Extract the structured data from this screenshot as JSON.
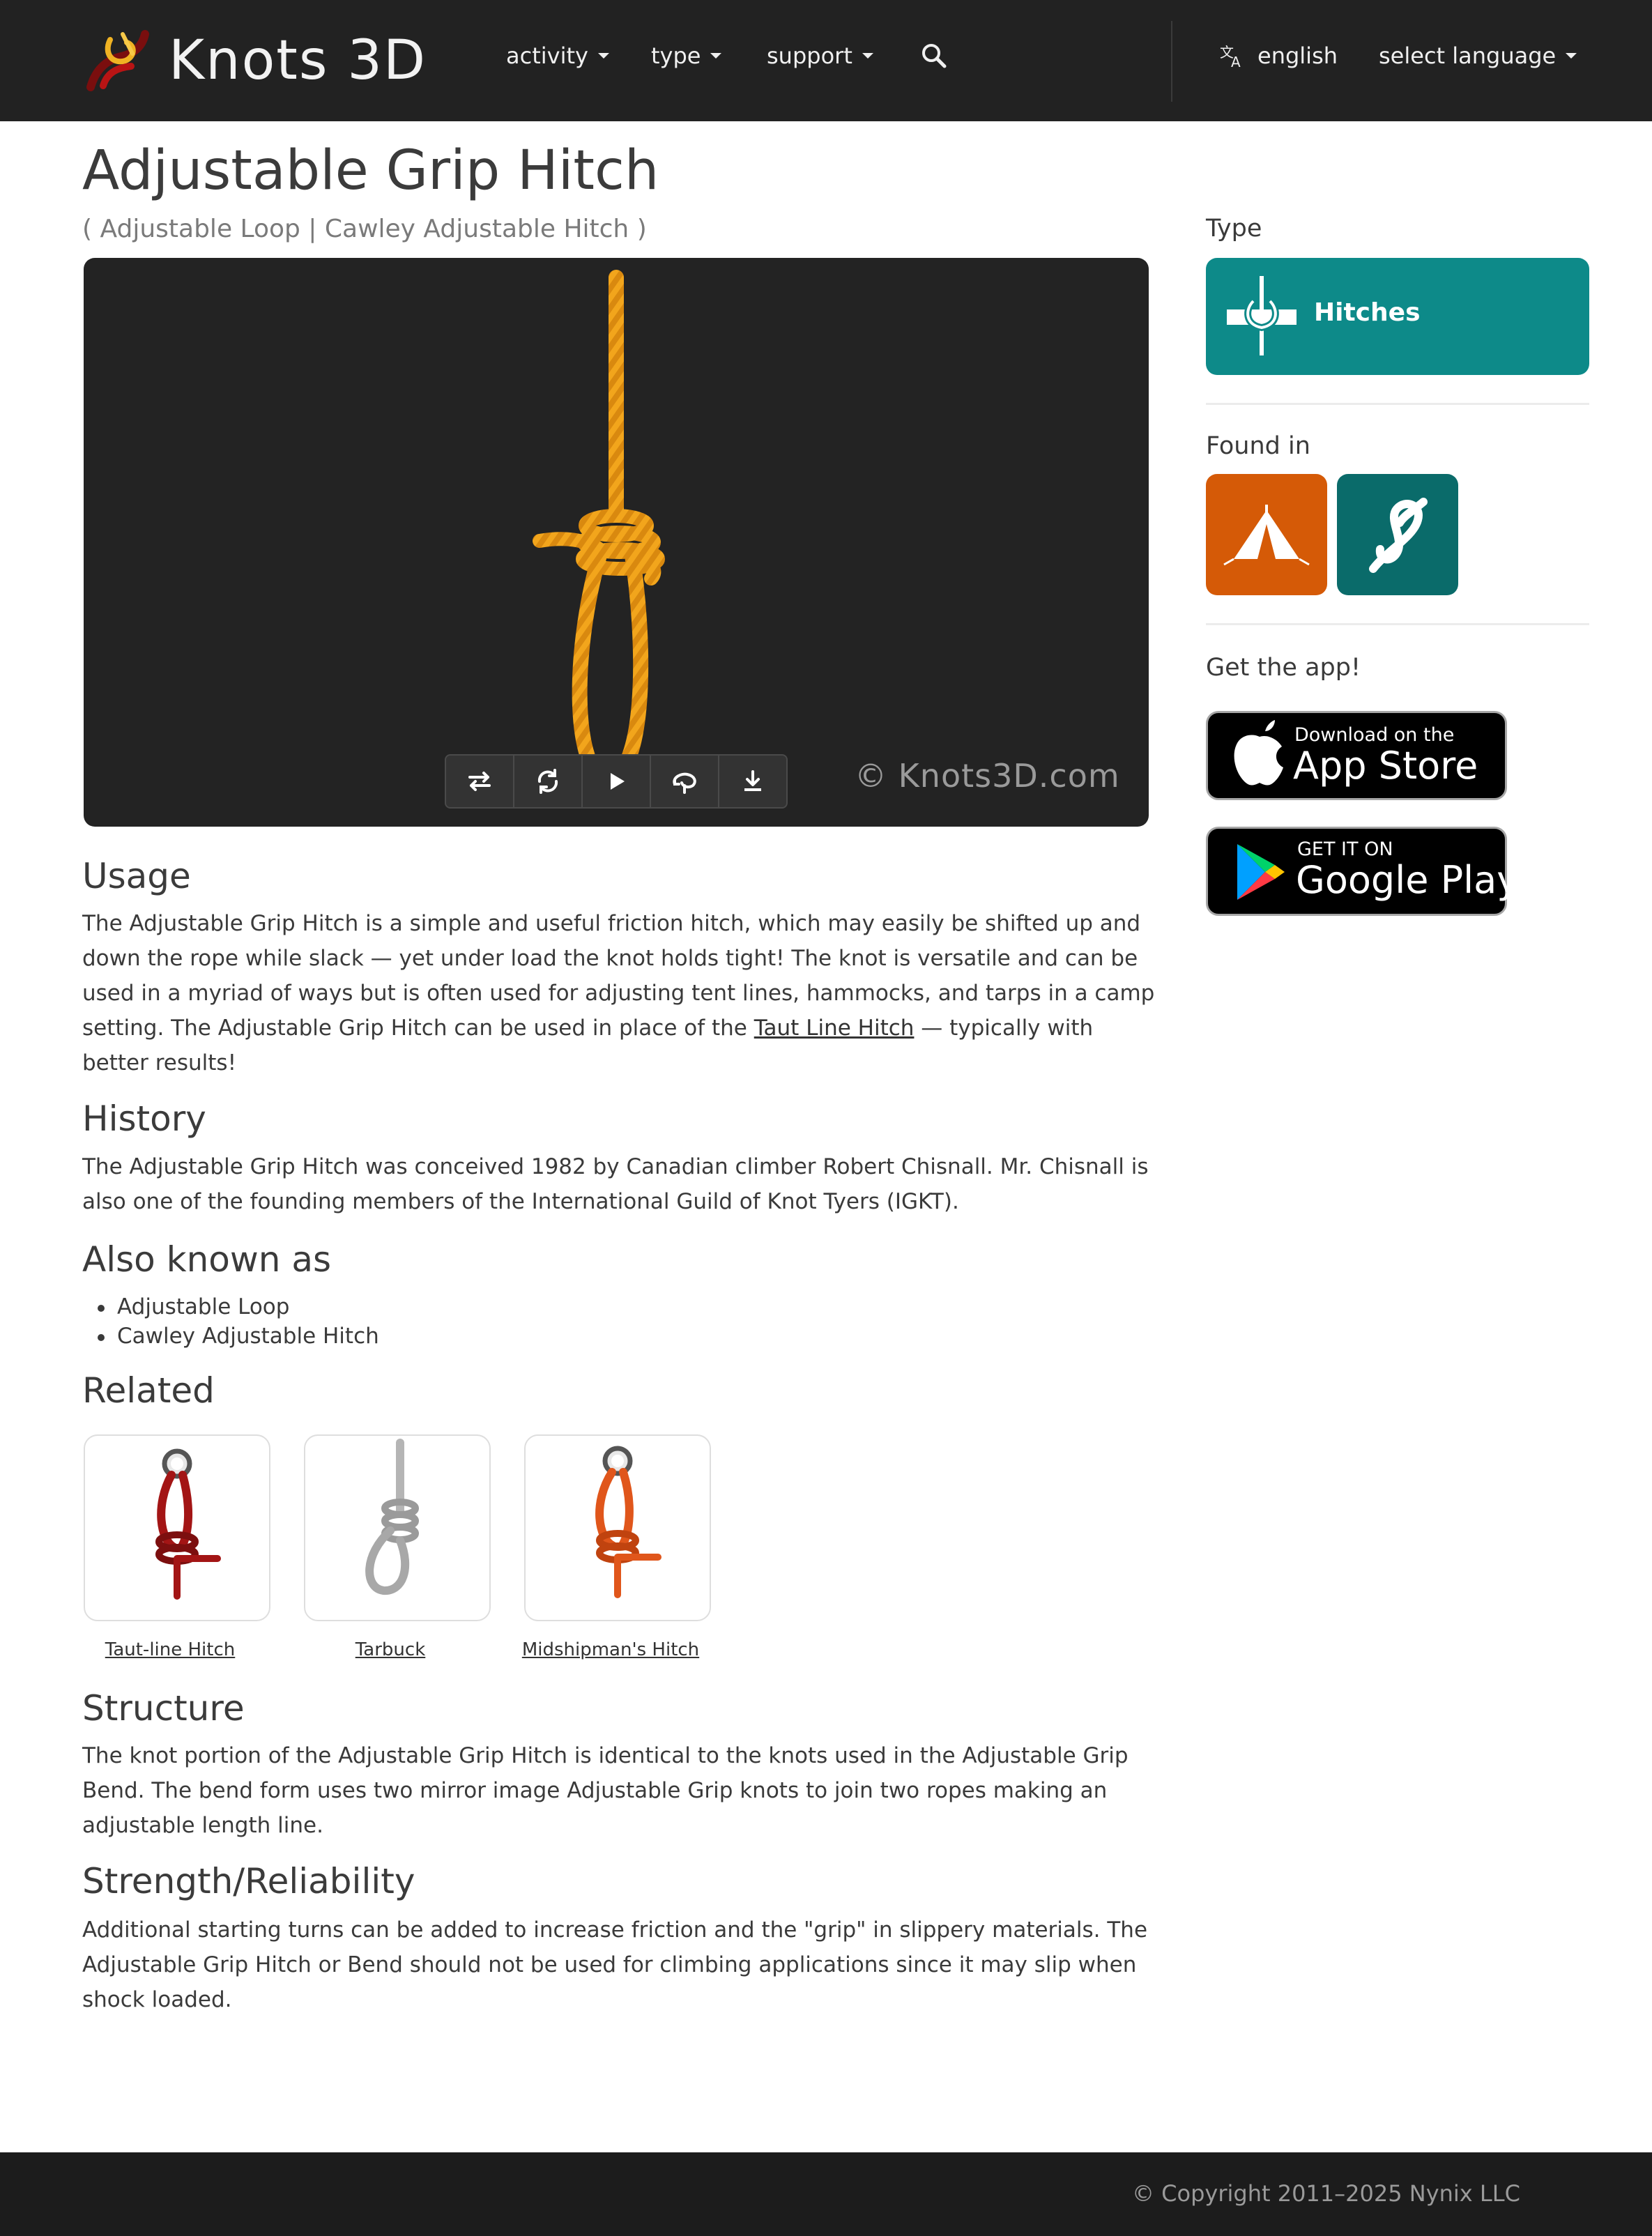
{
  "nav": {
    "brand": "Knots 3D",
    "menu": [
      {
        "label": "activity"
      },
      {
        "label": "type"
      },
      {
        "label": "support"
      }
    ],
    "language_current": "english",
    "language_select": "select language"
  },
  "page": {
    "title": "Adjustable Grip Hitch",
    "subtitle": "( Adjustable Loop | Cawley Adjustable Hitch )"
  },
  "viewer": {
    "watermark": "© Knots3D.com",
    "controls": [
      "swap-icon",
      "rotate-icon",
      "play-icon",
      "loop-icon",
      "download-icon"
    ]
  },
  "sections": {
    "usage": {
      "heading": "Usage",
      "text_before": "The Adjustable Grip Hitch is a simple and useful friction hitch, which may easily be shifted up and down the rope while slack — yet under load the knot holds tight! The knot is versatile and can be used in a myriad of ways but is often used for adjusting tent lines, hammocks, and tarps in a camp setting. The Adjustable Grip Hitch can be used in place of the ",
      "link": "Taut Line Hitch",
      "text_after": " — typically with better results!"
    },
    "history": {
      "heading": "History",
      "text": "The Adjustable Grip Hitch was conceived 1982 by Canadian climber Robert Chisnall. Mr. Chisnall is also one of the founding members of the International Guild of Knot Tyers (IGKT)."
    },
    "aka": {
      "heading": "Also known as",
      "items": [
        "Adjustable Loop",
        "Cawley Adjustable Hitch"
      ]
    },
    "related": {
      "heading": "Related",
      "items": [
        {
          "label": "Taut-line Hitch",
          "color": "#a31515"
        },
        {
          "label": "Tarbuck",
          "color": "#a8a8a8"
        },
        {
          "label": "Midshipman's Hitch",
          "color": "#e0561b"
        }
      ]
    },
    "structure": {
      "heading": "Structure",
      "text": "The knot portion of the Adjustable Grip Hitch is identical to the knots used in the Adjustable Grip Bend. The bend form uses two mirror image Adjustable Grip knots to join two ropes making an adjustable length line."
    },
    "strength": {
      "heading": "Strength/Reliability",
      "text": "Additional starting turns can be added to increase friction and the \"grip\" in slippery materials. The Adjustable Grip Hitch or Bend should not be used for climbing applications since it may slip when shock loaded."
    }
  },
  "sidebar": {
    "type_heading": "Type",
    "type_label": "Hitches",
    "type_color": "#0d8a89",
    "found_heading": "Found in",
    "found_tiles": [
      {
        "icon": "tent-icon",
        "color": "#d55a07"
      },
      {
        "icon": "knot-icon",
        "color": "#0a6b6a"
      }
    ],
    "app_heading": "Get the app!",
    "appstore": {
      "small": "Download on the",
      "big": "App Store"
    },
    "googleplay": {
      "small": "GET IT ON",
      "big": "Google Play"
    }
  },
  "footer": {
    "copyright": "© Copyright 2011–2025 Nynix LLC"
  }
}
